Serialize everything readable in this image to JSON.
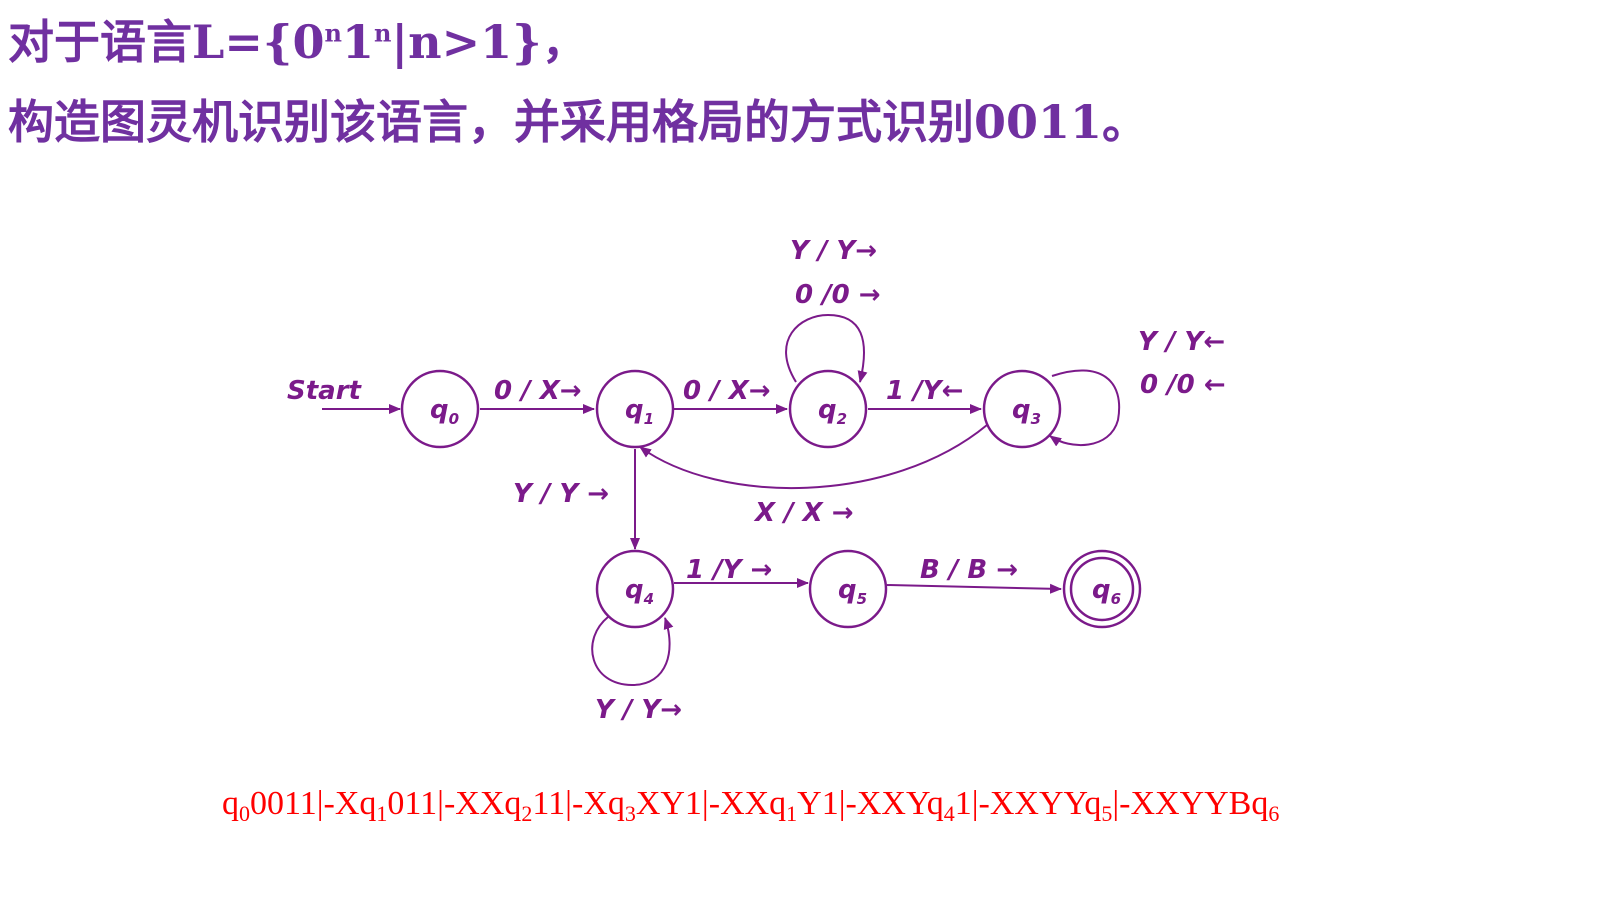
{
  "title": {
    "line1_prefix": "对于语言L={0",
    "line1_sup_1": "n",
    "line1_mid": "1",
    "line1_sup_2": "n",
    "line1_suffix": "|n>1}，",
    "line2": "构造图灵机识别该语言，并采用格局的方式识别0011。"
  },
  "diagram": {
    "start_label": "Start",
    "states": [
      {
        "id": "q0",
        "base": "q",
        "sub": "0"
      },
      {
        "id": "q1",
        "base": "q",
        "sub": "1"
      },
      {
        "id": "q2",
        "base": "q",
        "sub": "2"
      },
      {
        "id": "q3",
        "base": "q",
        "sub": "3"
      },
      {
        "id": "q4",
        "base": "q",
        "sub": "4"
      },
      {
        "id": "q5",
        "base": "q",
        "sub": "5"
      },
      {
        "id": "q6",
        "base": "q",
        "sub": "6",
        "accepting": true
      }
    ],
    "transitions": [
      {
        "from": "q0",
        "to": "q1",
        "label": "0 / X→"
      },
      {
        "from": "q1",
        "to": "q2",
        "label": "0 / X→"
      },
      {
        "from": "q2",
        "to": "q2",
        "labels": [
          "Y / Y→",
          "0 /0 →"
        ]
      },
      {
        "from": "q2",
        "to": "q3",
        "label": "1 /Y←"
      },
      {
        "from": "q3",
        "to": "q3",
        "labels": [
          "Y / Y←",
          "0 /0 ←"
        ]
      },
      {
        "from": "q3",
        "to": "q1",
        "label": "X / X  →"
      },
      {
        "from": "q1",
        "to": "q4",
        "label": "Y / Y →"
      },
      {
        "from": "q4",
        "to": "q4",
        "label": "Y / Y→"
      },
      {
        "from": "q4",
        "to": "q5",
        "label": "1 /Y →"
      },
      {
        "from": "q5",
        "to": "q6",
        "label": "B / B →"
      }
    ],
    "color": "#7b1a8a"
  },
  "answer": {
    "parts": [
      [
        "q",
        "0",
        "0011|-Xq"
      ],
      [
        "",
        "1",
        "011|-XXq"
      ],
      [
        "",
        "2",
        "11|-Xq"
      ],
      [
        "",
        "3",
        "XY1|-XXq"
      ],
      [
        "",
        "1",
        "Y1|-XXYq"
      ],
      [
        "",
        "4",
        "1|-XXYYq"
      ],
      [
        "",
        "5",
        "|-XXYYBq"
      ],
      [
        "",
        "6",
        ""
      ]
    ],
    "color": "#ff0000"
  }
}
